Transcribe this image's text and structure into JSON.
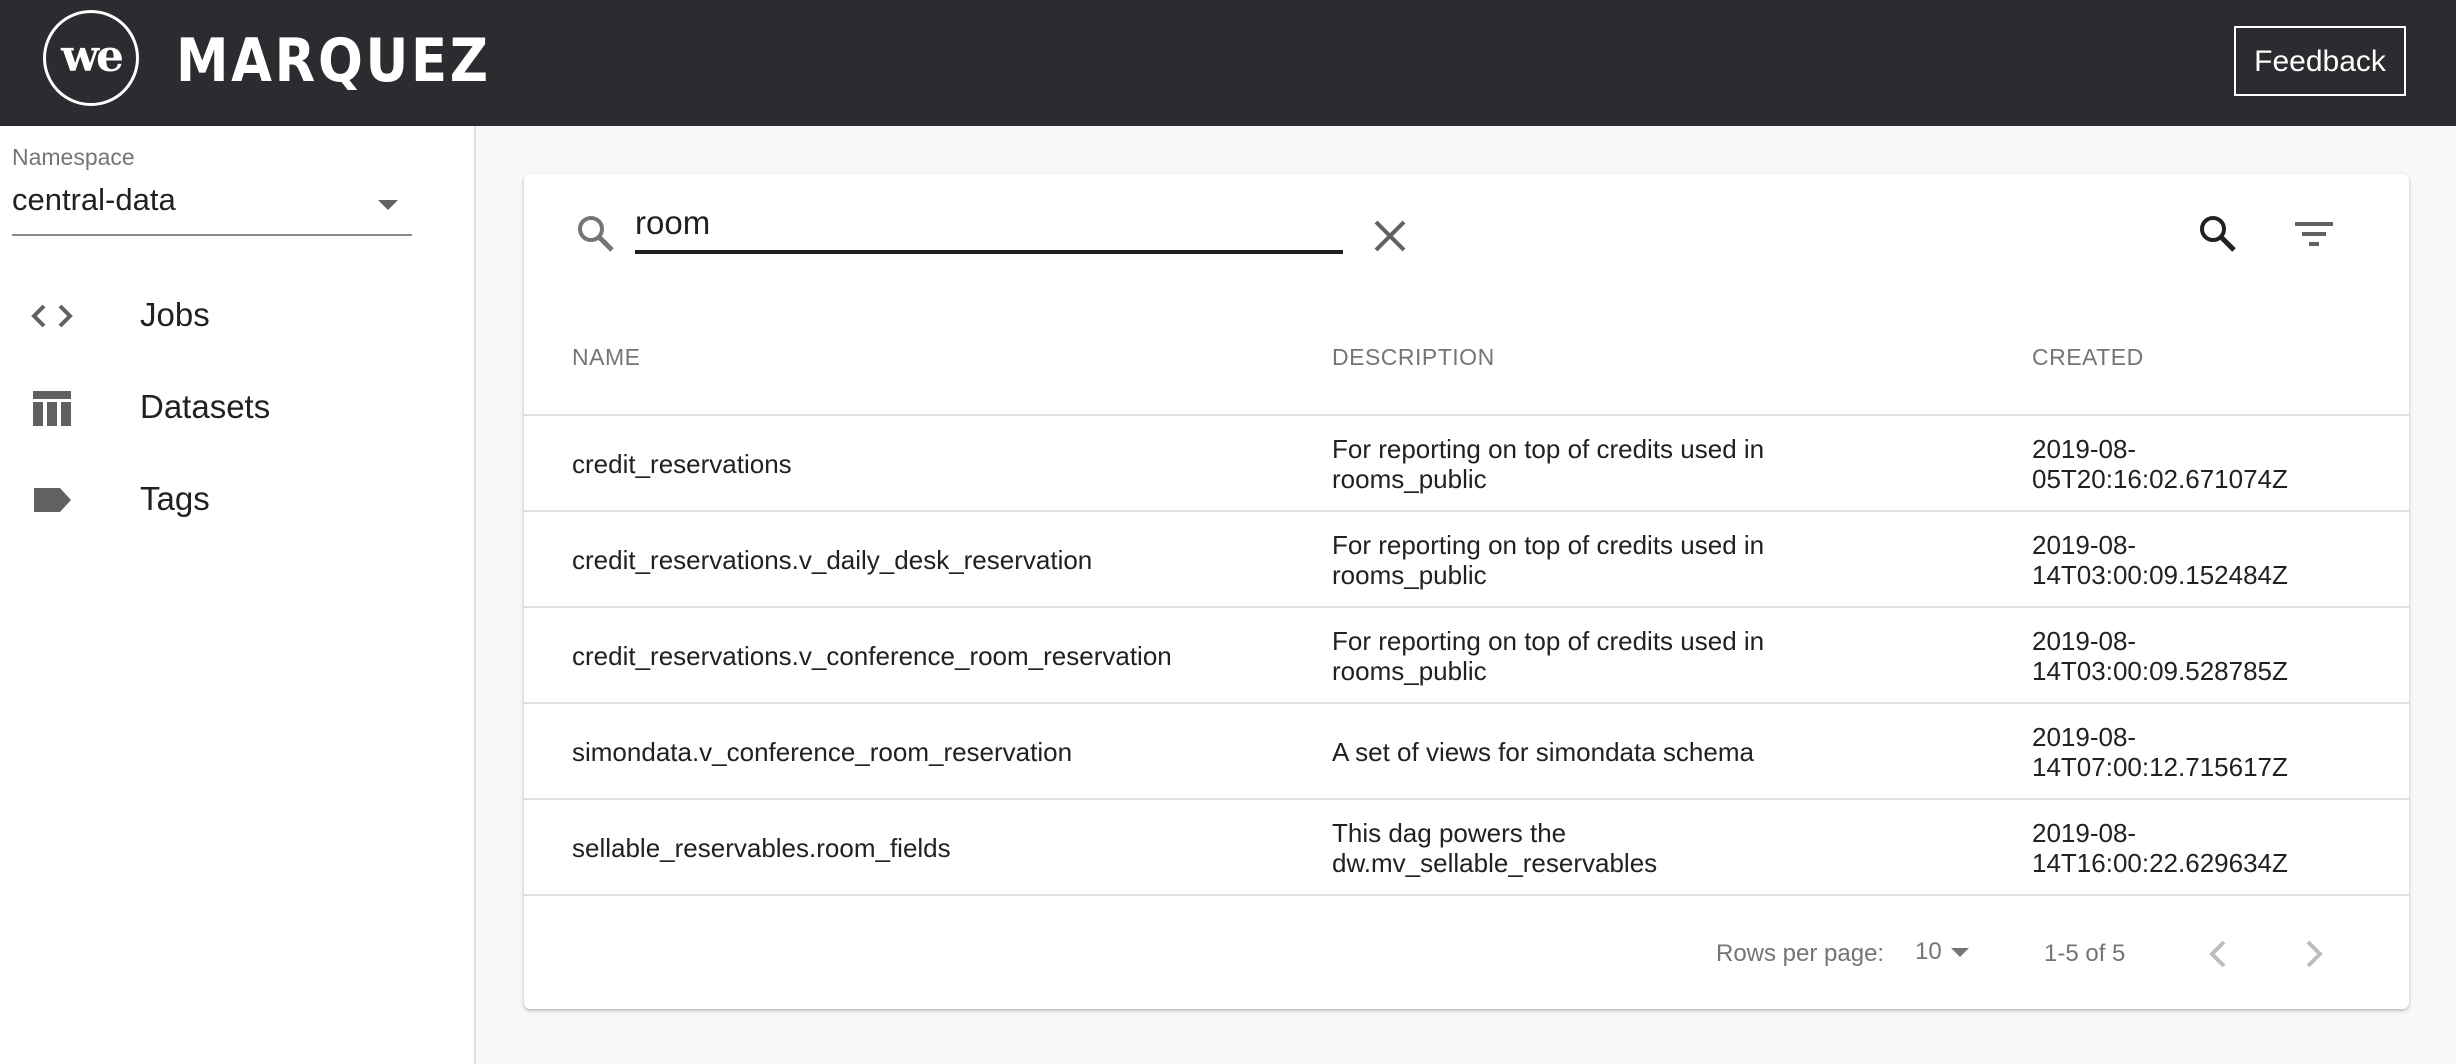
{
  "header": {
    "logo_text": "we",
    "brand": "MARQUEZ",
    "feedback_label": "Feedback"
  },
  "sidebar": {
    "namespace_label": "Namespace",
    "namespace_value": "central-data",
    "items": [
      {
        "label": "Jobs",
        "icon": "code-icon"
      },
      {
        "label": "Datasets",
        "icon": "table-icon"
      },
      {
        "label": "Tags",
        "icon": "label-icon"
      }
    ]
  },
  "search": {
    "value": "room",
    "placeholder": ""
  },
  "table": {
    "columns": [
      "NAME",
      "DESCRIPTION",
      "CREATED"
    ],
    "rows": [
      {
        "name": "credit_reservations",
        "description_1": "For reporting on top of credits used in",
        "description_2": "rooms_public",
        "created_1": "2019-08-",
        "created_2": "05T20:16:02.671074Z"
      },
      {
        "name": "credit_reservations.v_daily_desk_reservation",
        "description_1": "For reporting on top of credits used in",
        "description_2": "rooms_public",
        "created_1": "2019-08-",
        "created_2": "14T03:00:09.152484Z"
      },
      {
        "name": "credit_reservations.v_conference_room_reservation",
        "description_1": "For reporting on top of credits used in",
        "description_2": "rooms_public",
        "created_1": "2019-08-",
        "created_2": "14T03:00:09.528785Z"
      },
      {
        "name": "simondata.v_conference_room_reservation",
        "description_1": "A set of views for simondata schema",
        "description_2": "",
        "created_1": "2019-08-",
        "created_2": "14T07:00:12.715617Z"
      },
      {
        "name": "sellable_reservables.room_fields",
        "description_1": "This dag powers the",
        "description_2": "dw.mv_sellable_reservables",
        "created_1": "2019-08-",
        "created_2": "14T16:00:22.629634Z"
      }
    ]
  },
  "pagination": {
    "rows_per_page_label": "Rows per page:",
    "rows_per_page_value": "10",
    "range": "1-5 of 5"
  },
  "colors": {
    "appbar": "#2b2c2f",
    "background": "#f8f8f8",
    "text": "#212121",
    "muted": "#757575"
  }
}
